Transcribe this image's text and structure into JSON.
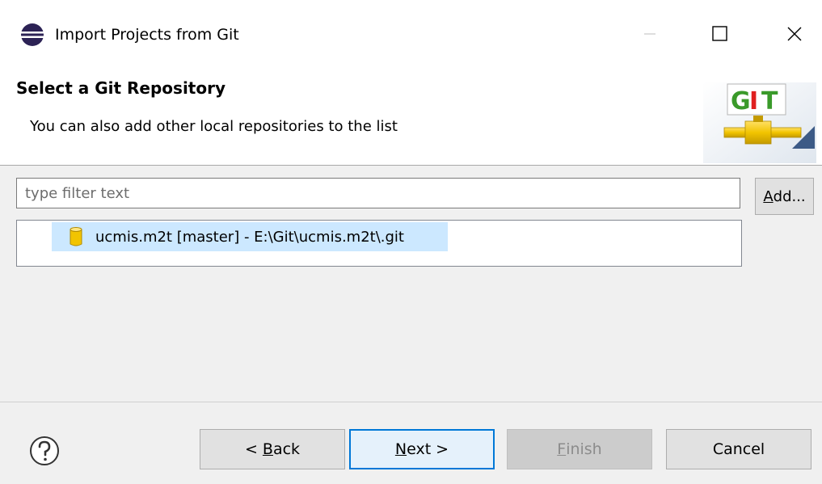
{
  "window": {
    "title": "Import Projects from Git",
    "icons": {
      "app": "eclipse-icon",
      "minimize": "minimize-icon",
      "maximize": "maximize-icon",
      "close": "close-icon"
    }
  },
  "header": {
    "title": "Select a Git Repository",
    "description": "You can also add other local repositories to the list",
    "logo_text": "GIT",
    "logo_icon": "git-logo-icon"
  },
  "filter": {
    "placeholder": "type filter text",
    "value": ""
  },
  "add_button": {
    "accel": "A",
    "rest": "dd..."
  },
  "repositories": [
    {
      "label": "ucmis.m2t [master] - E:\\Git\\ucmis.m2t\\.git",
      "icon": "repository-icon",
      "selected": true
    }
  ],
  "buttons": {
    "back": {
      "prefix": "< ",
      "accel": "B",
      "rest": "ack"
    },
    "next": {
      "accel": "N",
      "rest": "ext >"
    },
    "finish": {
      "accel": "F",
      "rest": "inish",
      "enabled": false
    },
    "cancel": {
      "label": "Cancel"
    }
  },
  "help_icon": "help-icon",
  "colors": {
    "selection": "#cce8ff",
    "focus_border": "#0078d7",
    "logo_green": "#3a9a2a",
    "logo_red": "#e02020",
    "logo_yellow": "#f2c400"
  }
}
